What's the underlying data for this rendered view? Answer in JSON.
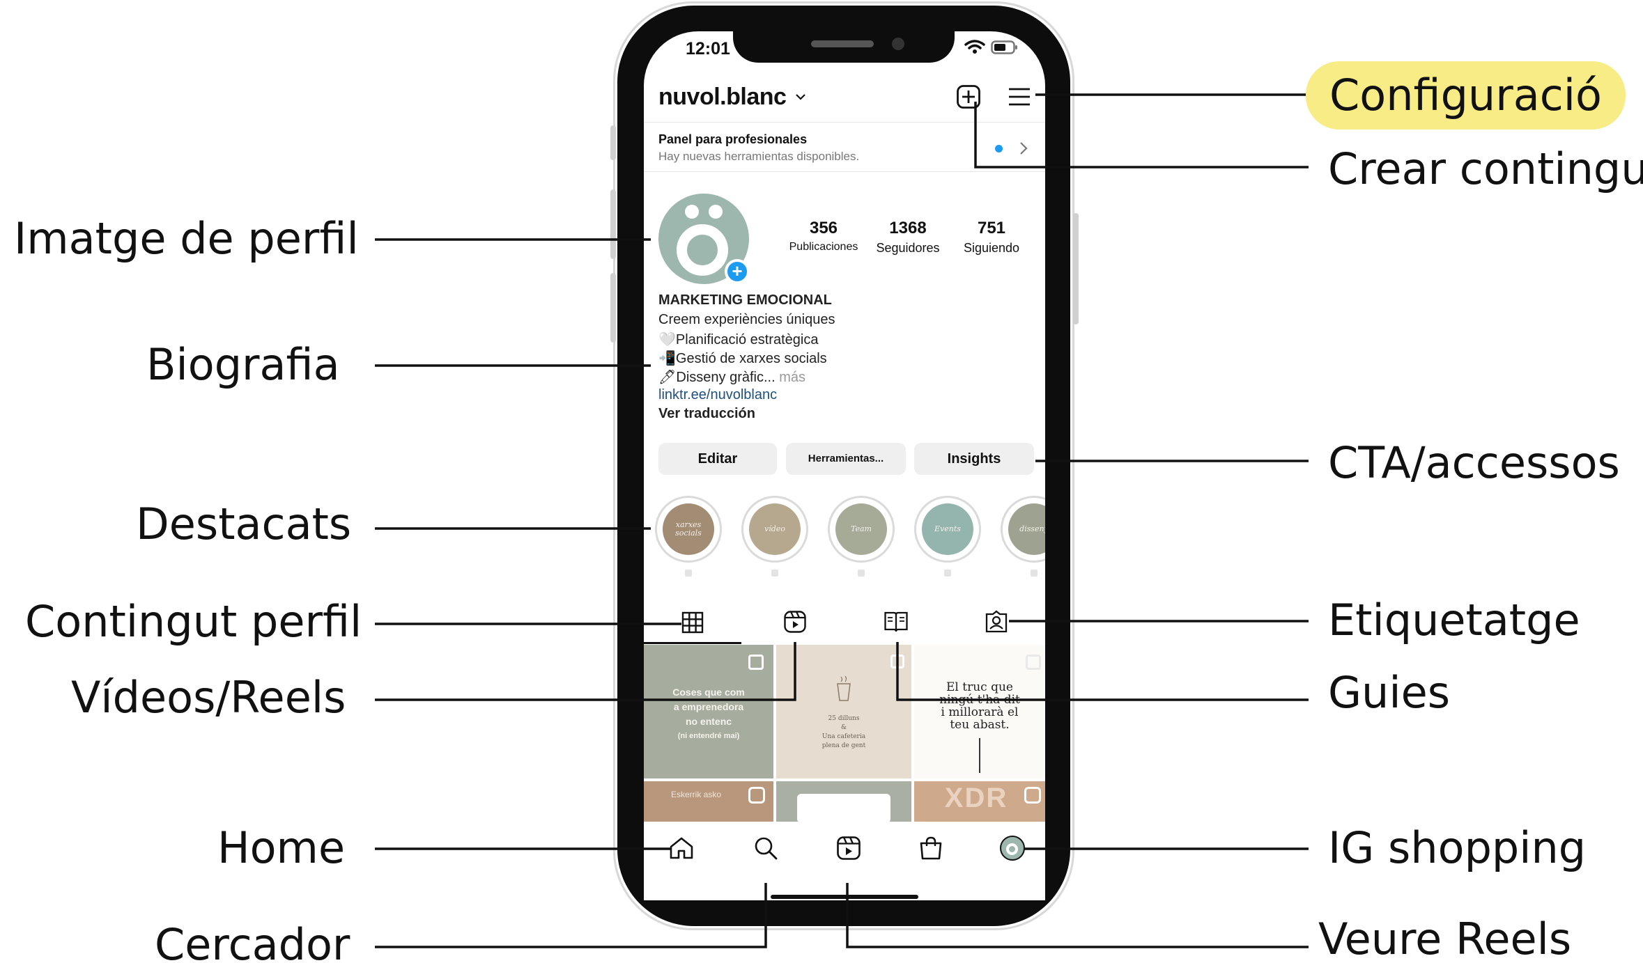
{
  "status_bar": {
    "time": "12:01"
  },
  "header": {
    "username": "nuvol.blanc",
    "chevron_icon": "chevron-down-icon",
    "create_icon": "plus-square-icon",
    "menu_icon": "hamburger-menu-icon"
  },
  "pro_panel": {
    "title": "Panel para profesionales",
    "subtitle": "Hay nuevas herramientas disponibles."
  },
  "stats": [
    {
      "value": "356",
      "label": "Publicaciones"
    },
    {
      "value": "1368",
      "label": "Seguidores"
    },
    {
      "value": "751",
      "label": "Siguiendo"
    }
  ],
  "bio": {
    "name": "MARKETING EMOCIONAL",
    "line1": "Creem experiències úniques",
    "line2": "🤍Planificació estratègica",
    "line3": "📲Gestió de xarxes socials",
    "line4": "🖊Disseny gràfic...",
    "more": "más",
    "link": "linktr.ee/nuvolblanc",
    "translate": "Ver traducción"
  },
  "actions": {
    "edit": "Editar",
    "tools": "Herramientas...",
    "insights": "Insights"
  },
  "highlights": [
    {
      "title": "xarxes socials",
      "color": "#a38c74"
    },
    {
      "title": "vídeo",
      "color": "#b6a88e"
    },
    {
      "title": "Team",
      "color": "#a6ab98"
    },
    {
      "title": "Events",
      "color": "#94b5ae"
    },
    {
      "title": "disseny",
      "color": "#9ea391"
    }
  ],
  "profile_tabs": [
    "grid-icon",
    "reels-icon",
    "guides-icon",
    "tagged-icon"
  ],
  "posts": {
    "tile1": {
      "line1": "Coses que com",
      "line2": "a emprenedora",
      "line3": "no entenc",
      "line4": "(ni entendré mai)"
    },
    "tile2": {
      "line1": "25 dilluns",
      "line2": "&",
      "line3": "Una cafeteria",
      "line4": "plena de gent"
    },
    "tile3": {
      "line1": "El truc que",
      "line2": "ningú t'ha dit",
      "line3": "i millorarà el",
      "line4": "teu abast."
    },
    "tile4": {
      "text": "Eskerrik asko"
    },
    "tile6": {
      "text": "XDR"
    }
  },
  "bottom_nav": [
    "home-icon",
    "search-icon",
    "reels-icon",
    "shop-icon",
    "profile-icon"
  ],
  "annotations": {
    "left": {
      "profile_image": "Imatge de perfil",
      "bio": "Biografia",
      "highlights": "Destacats",
      "profile_content": "Contingut perfil",
      "videos_reels": "Vídeos/Reels",
      "home": "Home",
      "search": "Cercador"
    },
    "right": {
      "settings": "Configuració",
      "create_content": "Crear contingut",
      "cta": "CTA/accessos",
      "tagging": "Etiquetatge",
      "guides": "Guies",
      "ig_shopping": "IG shopping",
      "see_reels": "Veure Reels"
    },
    "highlight_color": "#f8ec86"
  }
}
